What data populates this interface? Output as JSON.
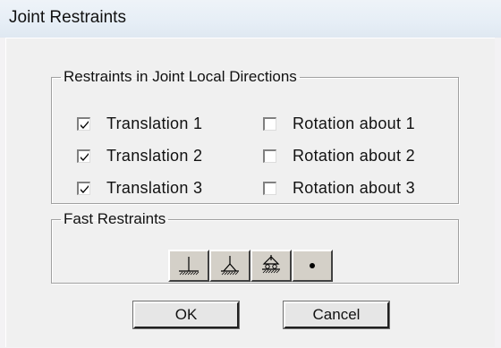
{
  "window": {
    "title": "Joint Restraints"
  },
  "restraints_group": {
    "legend": "Restraints in Joint Local Directions",
    "translations": [
      {
        "label": "Translation  1",
        "checked": true
      },
      {
        "label": "Translation  2",
        "checked": true
      },
      {
        "label": "Translation  3",
        "checked": true
      }
    ],
    "rotations": [
      {
        "label": "Rotation about  1",
        "checked": false
      },
      {
        "label": "Rotation about  2",
        "checked": false
      },
      {
        "label": "Rotation about  3",
        "checked": false
      }
    ]
  },
  "fast_group": {
    "legend": "Fast Restraints",
    "buttons": [
      {
        "icon": "fixed-support-icon"
      },
      {
        "icon": "pinned-support-icon"
      },
      {
        "icon": "roller-support-icon"
      },
      {
        "icon": "free-joint-icon"
      }
    ]
  },
  "actions": {
    "ok_label": "OK",
    "cancel_label": "Cancel"
  }
}
